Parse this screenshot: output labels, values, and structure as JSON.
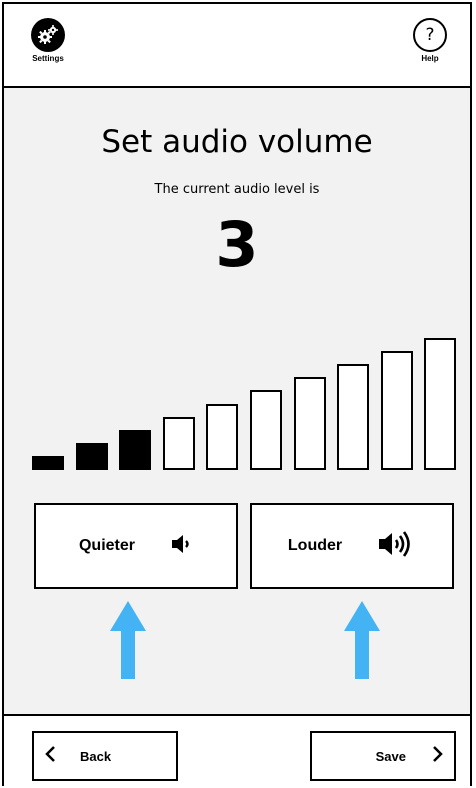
{
  "header": {
    "settings_label": "Settings",
    "settings_icon": "gears-icon",
    "help_label": "Help",
    "help_glyph": "?"
  },
  "main": {
    "title": "Set audio volume",
    "subtitle": "The current audio level is",
    "level": "3",
    "volume_levels_total": 10,
    "volume_level_active": 3
  },
  "controls": {
    "quieter_label": "Quieter",
    "louder_label": "Louder"
  },
  "footer": {
    "back_label": "Back",
    "save_label": "Save"
  },
  "colors": {
    "background": "#f2f2f2",
    "panel": "#ffffff",
    "ink": "#000000",
    "arrow": "#43b3f4"
  }
}
